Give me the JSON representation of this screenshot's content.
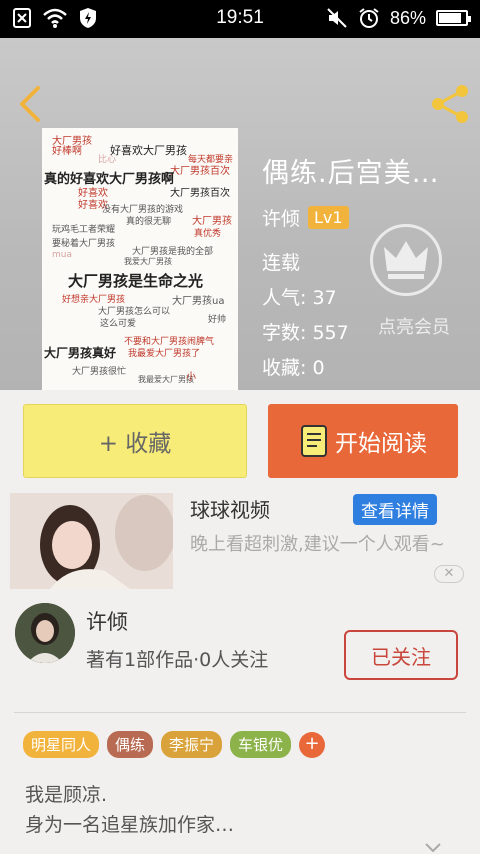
{
  "status": {
    "time": "19:51",
    "battery_pct": 86,
    "battery_label": "86%"
  },
  "book": {
    "title": "偶练.后宫美…",
    "author": "许倾",
    "level": "Lv1",
    "serial_status": "连载",
    "popularity_label": "人气:",
    "popularity": "37",
    "word_count_label": "字数:",
    "word_count": "557",
    "favorites_label": "收藏:",
    "favorites": "0",
    "vip_hint": "点亮会员"
  },
  "cover_words": [
    {
      "t": "大厂男孩",
      "c": "#c0392b"
    },
    {
      "t": "好喜欢大厂男孩",
      "c": "#222"
    },
    {
      "t": "好棒啊",
      "c": "#c0392b"
    },
    {
      "t": "每天都要亲",
      "c": "#c0392b"
    },
    {
      "t": "比心",
      "c": "#d6a3a0"
    },
    {
      "t": "大厂男孩百次",
      "c": "#c0392b"
    },
    {
      "t": "真的好喜欢大厂男孩啊",
      "c": "#222"
    },
    {
      "t": "好喜欢",
      "c": "#c0392b"
    },
    {
      "t": "大厂男孩百次",
      "c": "#222"
    },
    {
      "t": "好喜欢",
      "c": "#c0392b"
    },
    {
      "t": "没有大厂男孩的游戏",
      "c": "#555"
    },
    {
      "t": "真的很无聊",
      "c": "#555"
    },
    {
      "t": "大厂男孩",
      "c": "#c0392b"
    },
    {
      "t": "玩鸡毛工者荣耀",
      "c": "#555"
    },
    {
      "t": "真优秀",
      "c": "#c0392b"
    },
    {
      "t": "要秘着大厂男孩",
      "c": "#555"
    },
    {
      "t": "大厂男孩是我的全部",
      "c": "#555"
    },
    {
      "t": "mua",
      "c": "#d6a3a0"
    },
    {
      "t": "我爱大厂男孩",
      "c": "#555"
    },
    {
      "t": "大厂男孩是生命之光",
      "c": "#222"
    },
    {
      "t": "好想亲大厂男孩",
      "c": "#c0392b"
    },
    {
      "t": "大厂男孩ua",
      "c": "#555"
    },
    {
      "t": "大厂男孩怎么可以",
      "c": "#555"
    },
    {
      "t": "这么可爱",
      "c": "#555"
    },
    {
      "t": "好帅",
      "c": "#555"
    },
    {
      "t": "不要和大厂男孩闹脾气",
      "c": "#c0392b"
    },
    {
      "t": "大厂男孩真好",
      "c": "#222"
    },
    {
      "t": "我最爱大厂男孩了",
      "c": "#c0392b"
    },
    {
      "t": "大厂男孩很忙",
      "c": "#555"
    },
    {
      "t": "我最爱大厂男孩",
      "c": "#555"
    },
    {
      "t": "小",
      "c": "#c0392b"
    }
  ],
  "actions": {
    "collect_label": "+ 收藏",
    "read_label": "开始阅读"
  },
  "ad": {
    "title": "球球视频",
    "detail_label": "查看详情",
    "description": "晚上看超刺激,建议一个人观看~",
    "close_label": "✕"
  },
  "author_card": {
    "name": "许倾",
    "info": "著有1部作品·0人关注",
    "follow_label": "已关注"
  },
  "tags": [
    {
      "label": "明星同人",
      "color": "#f2b33d"
    },
    {
      "label": "偶练",
      "color": "#b86a52"
    },
    {
      "label": "李振宁",
      "color": "#d9a23a"
    },
    {
      "label": "车银优",
      "color": "#8cb24a"
    }
  ],
  "tag_add_label": "+",
  "intro": {
    "line1": "我是顾凉.",
    "line2": "身为一名追星族加作家…"
  },
  "colors": {
    "accent_orange": "#e8683a",
    "collect_yellow": "#f7ec77",
    "detail_blue": "#2f7fe0",
    "follow_red": "#c8463b"
  }
}
